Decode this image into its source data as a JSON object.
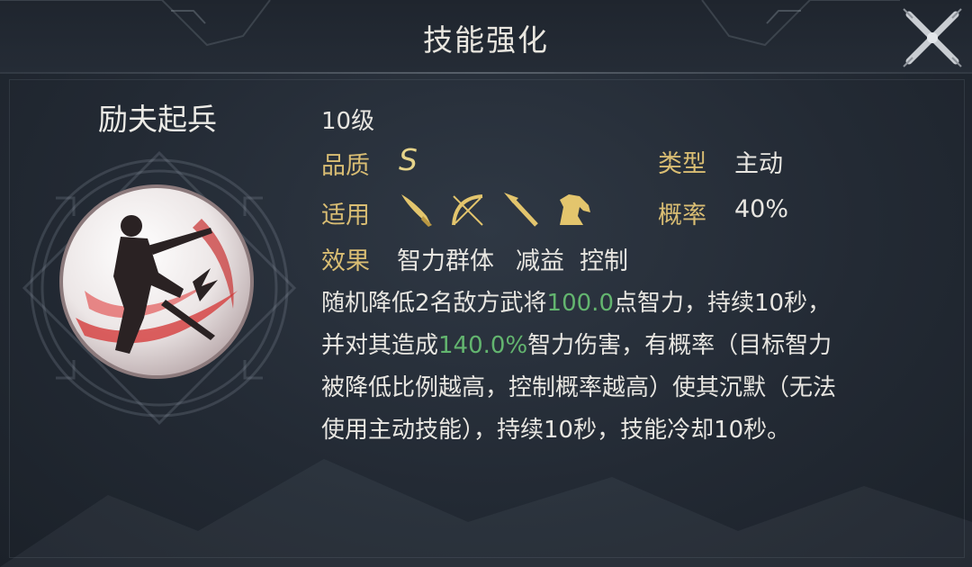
{
  "header": {
    "title": "技能强化"
  },
  "skill": {
    "name": "励夫起兵",
    "level": "10级",
    "quality_label": "品质",
    "quality_value": "S",
    "type_label": "类型",
    "type_value": "主动",
    "applicable_label": "适用",
    "applicable_icons": [
      "sword-icon",
      "bow-icon",
      "spear-icon",
      "horse-icon"
    ],
    "chance_label": "概率",
    "chance_value": "40%",
    "effect_label": "效果",
    "effect_tags": [
      "智力群体",
      "减益",
      "控制"
    ],
    "description": {
      "p1": "随机降低2名敌方武将",
      "v1": "100.0",
      "p2": "点智力，持续10秒，",
      "p3": "并对其造成",
      "v2": "140.0%",
      "p4": "智力伤害，有概率（目标智力",
      "p5": "被降低比例越高，控制概率越高）使其沉默（无法",
      "p6": "使用主动技能），持续10秒，技能冷却10秒。"
    }
  },
  "colors": {
    "label_gold": "#d9bd73",
    "highlight_green": "#63b56f",
    "text": "#e8e6e1",
    "background": "#252c36"
  }
}
